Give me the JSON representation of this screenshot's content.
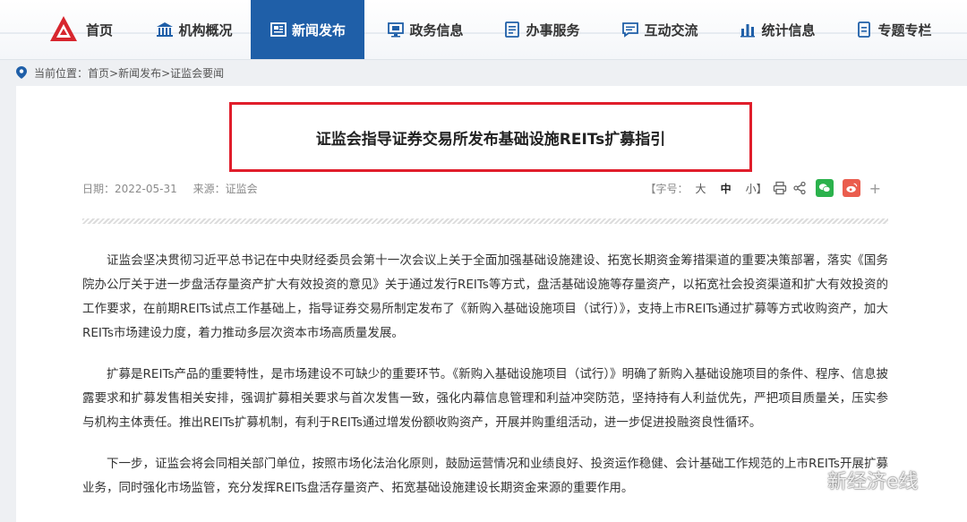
{
  "nav": {
    "items": [
      {
        "label": "首页"
      },
      {
        "label": "机构概况"
      },
      {
        "label": "新闻发布"
      },
      {
        "label": "政务信息"
      },
      {
        "label": "办事服务"
      },
      {
        "label": "互动交流"
      },
      {
        "label": "统计信息"
      },
      {
        "label": "专题专栏"
      }
    ],
    "active": "新闻发布",
    "active_color": "#1f5fa8"
  },
  "breadcrumb": {
    "prefix": "当前位置：",
    "path": "首页>新闻发布>证监会要闻"
  },
  "article": {
    "title": "证监会指导证券交易所发布基础设施REITs扩募指引",
    "date": "日期：2022-05-31",
    "source": "来源：证监会",
    "font_size_label": "【字号：",
    "font_large": "大",
    "font_medium": "中",
    "font_small": "小】",
    "paragraphs": [
      "证监会坚决贯彻习近平总书记在中央财经委员会第十一次会议上关于全面加强基础设施建设、拓宽长期资金筹措渠道的重要决策部署，落实《国务院办公厅关于进一步盘活存量资产扩大有效投资的意见》关于通过发行REITs等方式，盘活基础设施等存量资产，以拓宽社会投资渠道和扩大有效投资的工作要求，在前期REITs试点工作基础上，指导证券交易所制定发布了《新购入基础设施项目（试行）》，支持上市REITs通过扩募等方式收购资产，加大REITs市场建设力度，着力推动多层次资本市场高质量发展。",
      "扩募是REITs产品的重要特性，是市场建设不可缺少的重要环节。《新购入基础设施项目（试行）》明确了新购入基础设施项目的条件、程序、信息披露要求和扩募发售相关安排，强调扩募相关要求与首次发售一致，强化内幕信息管理和利益冲突防范，坚持持有人利益优先，严把项目质量关，压实参与机构主体责任。推出REITs扩募机制，有利于REITs通过增发份额收购资产，开展并购重组活动，进一步促进投融资良性循环。",
      "下一步，证监会将会同相关部门单位，按照市场化法治化原则，鼓励运营情况和业绩良好、投资运作稳健、会计基础工作规范的上市REITs开展扩募业务，同时强化市场监管，充分发挥REITs盘活存量资产、拓宽基础设施建设长期资金来源的重要作用。"
    ]
  },
  "watermark": {
    "text": "新经济e线"
  },
  "colors": {
    "highlight_border": "#e01e2b",
    "wechat": "#2bb24c",
    "weibo": "#ea5d4e"
  }
}
